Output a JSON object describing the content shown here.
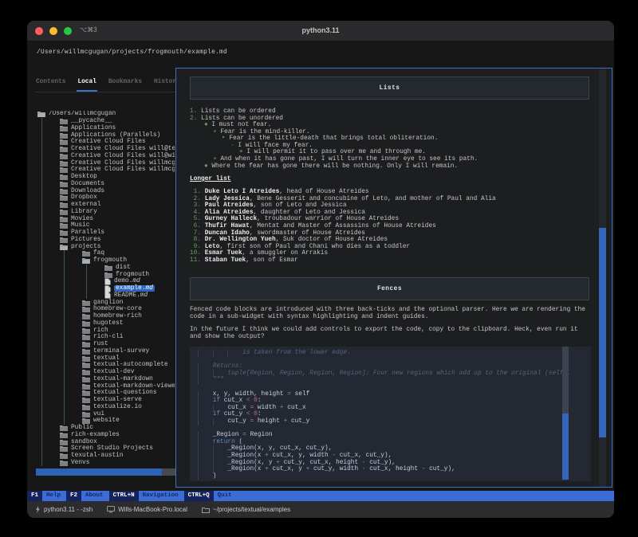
{
  "window": {
    "title": "python3.11",
    "badge": "⌥⌘3"
  },
  "path_bar": {
    "value": "/Users/willmcgugan/projects/frogmouth/example.md"
  },
  "tabs": [
    {
      "label": "Contents",
      "active": false
    },
    {
      "label": "Local",
      "active": true
    },
    {
      "label": "Bookmarks",
      "active": false
    },
    {
      "label": "History",
      "active": false
    }
  ],
  "tree": {
    "items": [
      {
        "depth": 0,
        "icon": "folder-open",
        "label": "/Users/willmcgugan"
      },
      {
        "depth": 1,
        "icon": "folder",
        "label": "__pycache__"
      },
      {
        "depth": 1,
        "icon": "folder",
        "label": "Applications"
      },
      {
        "depth": 1,
        "icon": "folder",
        "label": "Applications (Parallels)"
      },
      {
        "depth": 1,
        "icon": "folder",
        "label": "Creative Cloud Files"
      },
      {
        "depth": 1,
        "icon": "folder",
        "label": "Creative Cloud Files will@textu"
      },
      {
        "depth": 1,
        "icon": "folder",
        "label": "Creative Cloud Files will@willm"
      },
      {
        "depth": 1,
        "icon": "folder",
        "label": "Creative Cloud Files willmcguga"
      },
      {
        "depth": 1,
        "icon": "folder",
        "label": "Creative Cloud Files willmcguga"
      },
      {
        "depth": 1,
        "icon": "folder",
        "label": "Desktop"
      },
      {
        "depth": 1,
        "icon": "folder",
        "label": "Documents"
      },
      {
        "depth": 1,
        "icon": "folder",
        "label": "Downloads"
      },
      {
        "depth": 1,
        "icon": "folder",
        "label": "Dropbox"
      },
      {
        "depth": 1,
        "icon": "folder",
        "label": "external"
      },
      {
        "depth": 1,
        "icon": "folder",
        "label": "Library"
      },
      {
        "depth": 1,
        "icon": "folder",
        "label": "Movies"
      },
      {
        "depth": 1,
        "icon": "folder",
        "label": "Music"
      },
      {
        "depth": 1,
        "icon": "folder",
        "label": "Parallels"
      },
      {
        "depth": 1,
        "icon": "folder",
        "label": "Pictures"
      },
      {
        "depth": 1,
        "icon": "folder-open",
        "label": "projects"
      },
      {
        "depth": 2,
        "icon": "folder",
        "label": "faq"
      },
      {
        "depth": 2,
        "icon": "folder-open",
        "label": "frogmouth"
      },
      {
        "depth": 3,
        "icon": "folder",
        "label": "dist"
      },
      {
        "depth": 3,
        "icon": "folder",
        "label": "frogmouth"
      },
      {
        "depth": 3,
        "icon": "file",
        "label": "demo.",
        "ext": "md"
      },
      {
        "depth": 3,
        "icon": "file",
        "label": "example.",
        "ext": "md",
        "selected": true
      },
      {
        "depth": 3,
        "icon": "file",
        "label": "README.",
        "ext": "md"
      },
      {
        "depth": 2,
        "icon": "folder",
        "label": "ganglion"
      },
      {
        "depth": 2,
        "icon": "folder",
        "label": "homebrew-core"
      },
      {
        "depth": 2,
        "icon": "folder",
        "label": "homebrew-rich"
      },
      {
        "depth": 2,
        "icon": "folder",
        "label": "hugotest"
      },
      {
        "depth": 2,
        "icon": "folder",
        "label": "rich"
      },
      {
        "depth": 2,
        "icon": "folder",
        "label": "rich-cli"
      },
      {
        "depth": 2,
        "icon": "folder",
        "label": "rust"
      },
      {
        "depth": 2,
        "icon": "folder",
        "label": "terminal-survey"
      },
      {
        "depth": 2,
        "icon": "folder",
        "label": "textual"
      },
      {
        "depth": 2,
        "icon": "folder",
        "label": "textual-autocomplete"
      },
      {
        "depth": 2,
        "icon": "folder",
        "label": "textual-dev"
      },
      {
        "depth": 2,
        "icon": "folder",
        "label": "textual-markdown"
      },
      {
        "depth": 2,
        "icon": "folder",
        "label": "textual-markdown-viewer"
      },
      {
        "depth": 2,
        "icon": "folder",
        "label": "textual-questions"
      },
      {
        "depth": 2,
        "icon": "folder",
        "label": "textual-serve"
      },
      {
        "depth": 2,
        "icon": "folder",
        "label": "textualize.io"
      },
      {
        "depth": 2,
        "icon": "folder",
        "label": "vui"
      },
      {
        "depth": 2,
        "icon": "folder",
        "label": "website"
      },
      {
        "depth": 1,
        "icon": "folder",
        "label": "Public"
      },
      {
        "depth": 1,
        "icon": "folder",
        "label": "rich-examples"
      },
      {
        "depth": 1,
        "icon": "folder",
        "label": "sandbox"
      },
      {
        "depth": 1,
        "icon": "folder",
        "label": "Screen Studio Projects"
      },
      {
        "depth": 1,
        "icon": "folder",
        "label": "texutal-austin"
      },
      {
        "depth": 1,
        "icon": "folder",
        "label": "Venvs"
      }
    ]
  },
  "doc": {
    "lists_header": "Lists",
    "intro_items": [
      {
        "marker": "1.",
        "text": "Lists can be ordered"
      },
      {
        "marker": "2.",
        "text": "Lists can be unordered"
      }
    ],
    "bullets": [
      {
        "depth": 1,
        "marker": "●",
        "text": "I must not fear."
      },
      {
        "depth": 2,
        "marker": "▪",
        "text": "Fear is the mind-killer."
      },
      {
        "depth": 3,
        "marker": "‣",
        "text": "Fear is the little-death that brings total obliteration."
      },
      {
        "depth": 4,
        "marker": "·",
        "text": "I will face my fear."
      },
      {
        "depth": 5,
        "marker": "✶",
        "text": "I will permit it to pass over me and through me."
      },
      {
        "depth": 2,
        "marker": "▪",
        "text": "And when it has gone past, I will turn the inner eye to see its path."
      },
      {
        "depth": 1,
        "marker": "●",
        "text": "Where the fear has gone there will be nothing. Only I will remain."
      }
    ],
    "longer_list_title": "Longer list",
    "characters": [
      {
        "name": "Duke Leto I Atreides",
        "rest": ", head of House Atreides"
      },
      {
        "name": "Lady Jessica",
        "rest": ", Bene Gesserit and concubine of Leto, and mother of Paul and Alia"
      },
      {
        "name": "Paul Atreides",
        "rest": ", son of Leto and Jessica"
      },
      {
        "name": "Alia Atreides",
        "rest": ", daughter of Leto and Jessica"
      },
      {
        "name": "Gurney Halleck",
        "rest": ", troubadour warrior of House Atreides"
      },
      {
        "name": "Thufir Hawat",
        "rest": ", Mentat and Master of Assassins of House Atreides"
      },
      {
        "name": "Duncan Idaho",
        "rest": ", swordmaster of House Atreides"
      },
      {
        "name": "Dr. Wellington Yueh",
        "rest": ", Suk doctor of House Atreides"
      },
      {
        "name": "Leto",
        "rest": ", first son of Paul and Chani who dies as a toddler"
      },
      {
        "name": "Esmar Tuek",
        "rest": ", a smuggler on Arrakis"
      },
      {
        "name": "Staban Tuek",
        "rest": ", son of Esmar"
      }
    ],
    "fences_header": "Fences",
    "paragraphs": [
      "Fenced code blocks are introduced with three back-ticks and the optional parser. Here we are rendering the code in a sub-widget with syntax highlighting and indent guides.",
      "In the future I think we could add controls to export the code, copy to the clipboard. Heck, even run it and show the output?"
    ],
    "code_lines": [
      {
        "indent": 3,
        "tokens": [
          [
            "ds",
            "is taken from the lower edge."
          ]
        ]
      },
      {
        "indent": 0,
        "tokens": []
      },
      {
        "indent": 1,
        "tokens": [
          [
            "ds",
            "Returns:"
          ]
        ]
      },
      {
        "indent": 2,
        "tokens": [
          [
            "ds",
            "tuple[Region, Region, Region, Region]: Four new regions which add up to the original (self)."
          ]
        ]
      },
      {
        "indent": 1,
        "tokens": [
          [
            "ds",
            "\"\"\""
          ]
        ]
      },
      {
        "indent": 0,
        "tokens": []
      },
      {
        "indent": 1,
        "tokens": [
          [
            "t",
            "x, y, width, height "
          ],
          [
            "o",
            "= "
          ],
          [
            "t",
            "self"
          ]
        ]
      },
      {
        "indent": 1,
        "tokens": [
          [
            "k",
            "if "
          ],
          [
            "t",
            "cut_x "
          ],
          [
            "o",
            "< "
          ],
          [
            "n",
            "0"
          ],
          [
            "t",
            ":"
          ]
        ]
      },
      {
        "indent": 2,
        "tokens": [
          [
            "t",
            "cut_x "
          ],
          [
            "o",
            "= "
          ],
          [
            "t",
            "width "
          ],
          [
            "o",
            "+ "
          ],
          [
            "t",
            "cut_x"
          ]
        ]
      },
      {
        "indent": 1,
        "tokens": [
          [
            "k",
            "if "
          ],
          [
            "t",
            "cut_y "
          ],
          [
            "o",
            "< "
          ],
          [
            "n",
            "0"
          ],
          [
            "t",
            ":"
          ]
        ]
      },
      {
        "indent": 2,
        "tokens": [
          [
            "t",
            "cut_y "
          ],
          [
            "o",
            "= "
          ],
          [
            "t",
            "height "
          ],
          [
            "o",
            "+ "
          ],
          [
            "t",
            "cut_y"
          ]
        ]
      },
      {
        "indent": 0,
        "tokens": []
      },
      {
        "indent": 1,
        "tokens": [
          [
            "t",
            "_Region "
          ],
          [
            "o",
            "= "
          ],
          [
            "t",
            "Region"
          ]
        ]
      },
      {
        "indent": 1,
        "tokens": [
          [
            "k",
            "return "
          ],
          [
            "t",
            "("
          ]
        ]
      },
      {
        "indent": 2,
        "tokens": [
          [
            "t",
            "_Region(x, y, cut_x, cut_y),"
          ]
        ]
      },
      {
        "indent": 2,
        "tokens": [
          [
            "t",
            "_Region(x "
          ],
          [
            "o",
            "+ "
          ],
          [
            "t",
            "cut_x, y, width "
          ],
          [
            "o",
            "- "
          ],
          [
            "t",
            "cut_x, cut_y),"
          ]
        ]
      },
      {
        "indent": 2,
        "tokens": [
          [
            "t",
            "_Region(x, y "
          ],
          [
            "o",
            "+ "
          ],
          [
            "t",
            "cut_y, cut_x, height "
          ],
          [
            "o",
            "- "
          ],
          [
            "t",
            "cut_y),"
          ]
        ]
      },
      {
        "indent": 2,
        "tokens": [
          [
            "t",
            "_Region(x "
          ],
          [
            "o",
            "+ "
          ],
          [
            "t",
            "cut_x, y "
          ],
          [
            "o",
            "+ "
          ],
          [
            "t",
            "cut_y, width "
          ],
          [
            "o",
            "- "
          ],
          [
            "t",
            "cut_x, height "
          ],
          [
            "o",
            "- "
          ],
          [
            "t",
            "cut_y),"
          ]
        ]
      },
      {
        "indent": 1,
        "tokens": [
          [
            "t",
            ")"
          ]
        ]
      }
    ]
  },
  "footer": {
    "items": [
      {
        "key": "F1",
        "label": "Help"
      },
      {
        "key": "F2",
        "label": "About"
      },
      {
        "key": "CTRL+N",
        "label": "Navigation"
      },
      {
        "key": "CTRL+Q",
        "label": "Quit"
      }
    ]
  },
  "statusbar": {
    "session": "python3.11 - -zsh",
    "host": "Wills-MacBook-Pro.local",
    "cwd": "~/projects/textual/examples"
  },
  "colors": {
    "accent_blue": "#3e70ca",
    "selection_blue": "#2f66c0",
    "footer_blue": "#3c6dd6",
    "list_green": "#63a05c",
    "tree_guide_green": "#3e5743",
    "code_bg": "#232833",
    "traffic_red": "#ff5f57",
    "traffic_yellow": "#febc2e",
    "traffic_green": "#28c840"
  }
}
